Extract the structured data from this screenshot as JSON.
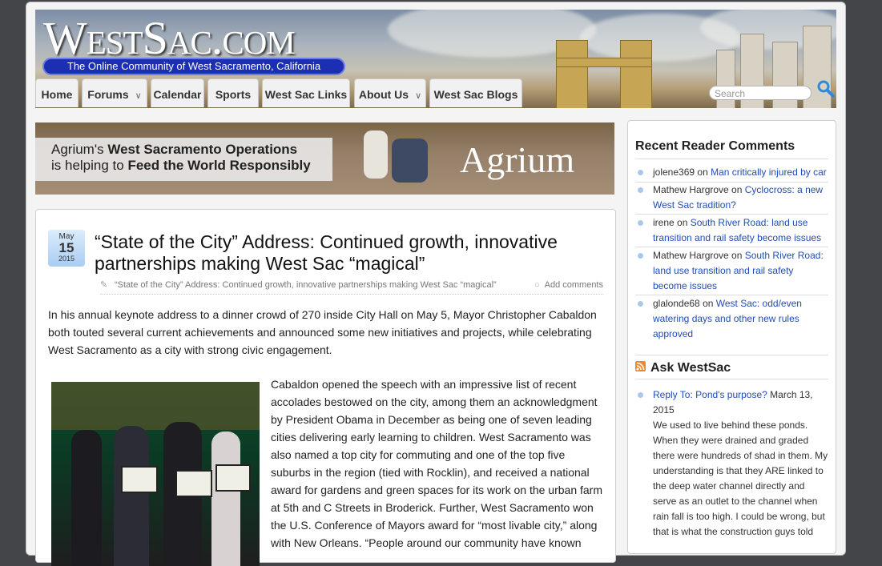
{
  "site": {
    "logo": "WestSac.com",
    "tagline": "The Online Community of West Sacramento, California"
  },
  "nav": {
    "tabs": [
      {
        "label": "Home",
        "dropdown": false
      },
      {
        "label": "Forums",
        "dropdown": true
      },
      {
        "label": "Calendar",
        "dropdown": false
      },
      {
        "label": "Sports",
        "dropdown": false
      },
      {
        "label": "West Sac Links",
        "dropdown": false
      },
      {
        "label": "About Us",
        "dropdown": true
      },
      {
        "label": "West Sac Blogs",
        "dropdown": false
      }
    ],
    "search_placeholder": "Search"
  },
  "ad": {
    "line1_plain": "Agrium's ",
    "line1_bold": "West Sacramento Operations",
    "line2_plain": "is helping to ",
    "line2_bold": "Feed the World Responsibly",
    "brand": "Agrium"
  },
  "post": {
    "date": {
      "month": "May",
      "day": "15",
      "year": "2015"
    },
    "title": "“State of the City” Address: Continued growth, innovative partnerships making West Sac “magical”",
    "tag": "“State of the City” Address: Continued growth, innovative partnerships making West Sac “magical”",
    "comments_link": "Add comments",
    "intro": "In his annual keynote address to a dinner crowd of 270 inside City Hall on May 5, Mayor Christopher Cabaldon both touted several current achievements and announced some new initiatives and projects, while celebrating West Sacramento as a city with strong civic engagement.",
    "body": "Cabaldon opened the speech with an impressive list of recent accolades bestowed on the city, among them an acknowledgment by President Obama in December as being one of seven leading cities delivering early learning to children. West Sacramento was also named a top city for commuting and one of the top five suburbs in the region (tied with Rocklin), and received a national award for gardens and green spaces for its work on the urban farm at 5th and C Streets in Broderick. Further, West Sacramento won the U.S. Conference of Mayors award for “most livable city,” along with New Orleans. “People around our community have known"
  },
  "sidebar": {
    "recent_title": "Recent Reader Comments",
    "recent": [
      {
        "author": "jolene369",
        "on": " on ",
        "link": "Man critically injured by car"
      },
      {
        "author": "Mathew Hargrove",
        "on": " on ",
        "link": "Cyclocross: a new West Sac tradition?"
      },
      {
        "author": "irene",
        "on": " on ",
        "link": "South River Road: land use transition and rail safety become issues"
      },
      {
        "author": "Mathew Hargrove",
        "on": " on ",
        "link": "South River Road: land use transition and rail safety become issues"
      },
      {
        "author": "glalonde68",
        "on": " on ",
        "link": "West Sac: odd/even watering days and other new rules approved"
      }
    ],
    "ask_title": "Ask WestSac",
    "ask_item": {
      "link": "Reply To: Pond's purpose?",
      "date": " March 13, 2015",
      "text": "We used to live behind these ponds. When they were drained and graded there were hundreds of shad in them. My understanding is that they ARE linked to the deep water channel directly and serve as an outlet to the channel when rain fall is too high. I could be wrong, but that is what the construction guys told"
    }
  },
  "colors": {
    "link": "#1f4db8",
    "tagline_bg": "#1c2fb4",
    "bullet": "#a9c9ec"
  }
}
